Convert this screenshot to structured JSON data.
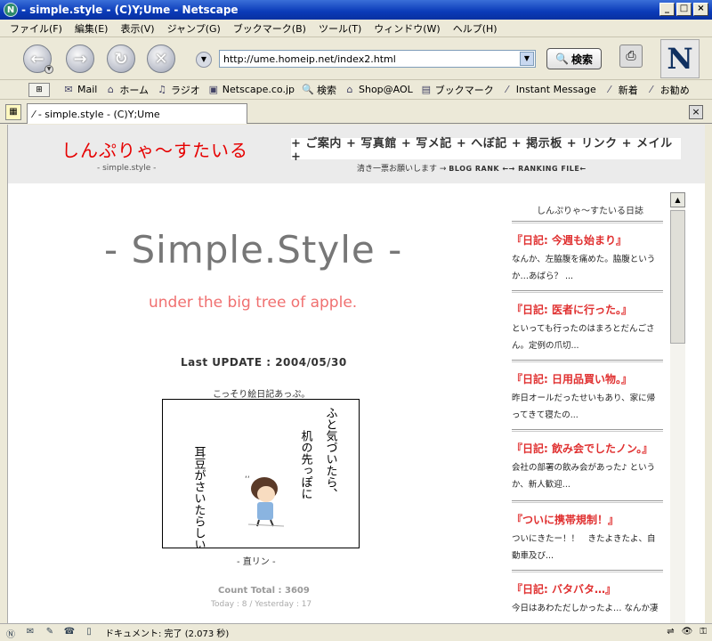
{
  "window": {
    "title": "- simple.style - (C)Y;Ume - Netscape",
    "buttons": {
      "minimize": "_",
      "maximize": "□",
      "close": "×"
    }
  },
  "menu": [
    "ファイル(F)",
    "編集(E)",
    "表示(V)",
    "ジャンプ(G)",
    "ブックマーク(B)",
    "ツール(T)",
    "ウィンドウ(W)",
    "ヘルプ(H)"
  ],
  "nav": {
    "url": "http://ume.homeip.net/index2.html",
    "search_label": "検索"
  },
  "personal_toolbar": [
    "Mail",
    "ホーム",
    "ラジオ",
    "Netscape.co.jp",
    "検索",
    "Shop@AOL",
    "ブックマーク",
    "Instant Message",
    "新着",
    "お勧め"
  ],
  "tab": {
    "label": "- simple.style - (C)Y;Ume"
  },
  "site": {
    "title": "しんぷりゃ〜すたいる",
    "subtitle": "- simple.style -",
    "nav": "+ ご案内 + 写真館 + 写メ記 + へぼ記 + 掲示板 + リンク + メイル +",
    "vote_text": "清き一票お願いします →",
    "vote_links": "BLOG RANK ←→ RANKING FILE←"
  },
  "main": {
    "big_title": "- Simple.Style -",
    "tagline": "under the big tree of apple.",
    "last_update": "Last UPDATE : 2004/05/30",
    "pic_caption": "こっそり絵日記あっぷ。",
    "pic_text_right": "ふと気づいたら、",
    "pic_text_mid": "机の先っぽに",
    "pic_text_left": "耳豆がさいたらしい。",
    "pic_note": "- 直リン -",
    "count": "Count Total : 3609",
    "count_sub": "Today : 8 / Yesterday : 17"
  },
  "sidebar": {
    "heading": "しんぷりゃ〜すたいる日誌",
    "entries": [
      {
        "title": "『日記: 今週も始まり』",
        "body": "なんか、左脇腹を痛めた。脇腹というか…あばら？ ..."
      },
      {
        "title": "『日記: 医者に行った。』",
        "body": "といっても行ったのはまろとだんごさん。定例の爪切..."
      },
      {
        "title": "『日記: 日用品買い物。』",
        "body": "昨日オールだったせいもあり、家に帰ってきて寝たの..."
      },
      {
        "title": "『日記: 飲み会でしたノン。』",
        "body": "会社の部署の飲み会があった♪ というか、新人歓迎..."
      },
      {
        "title": "『ついに携帯規制！』",
        "body": "ついにきたー！！　きたよきたよ、自動車及び..."
      },
      {
        "title": "『日記: バタバタ…』",
        "body": "今日はあわただしかったよ… なんか凄"
      }
    ]
  },
  "status": {
    "text": "ドキュメント: 完了 (2.073 秒)"
  },
  "icons": {
    "app": "netscape-icon",
    "back": "back-arrow-icon",
    "forward": "forward-arrow-icon",
    "reload": "reload-icon",
    "stop": "stop-icon",
    "search": "magnifier-icon"
  }
}
